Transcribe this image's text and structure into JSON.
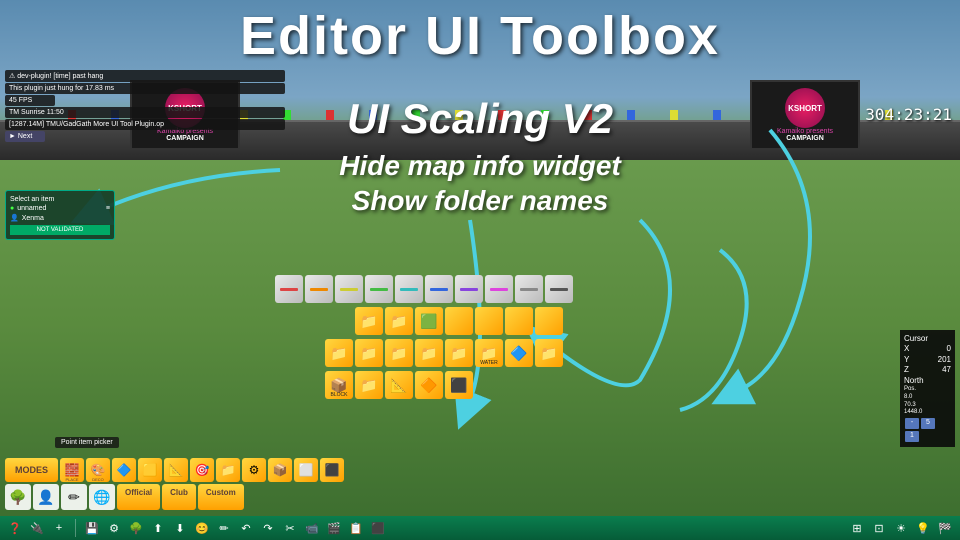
{
  "headline": {
    "h1": "Editor UI Toolbox",
    "h2": "UI Scaling V2",
    "h3": "Hide map info widget",
    "h4": "Show folder names"
  },
  "screens": {
    "brand": "KSHORT",
    "sub": "CAMPAIGN",
    "presents": "Kamaiko presents"
  },
  "timer": "304:23:21",
  "topleft": {
    "plugin": "⚠ dev-plugin! [time] past hang",
    "pluginmsg": "This plugin just hung for 17.83 ms",
    "fps": "45 FPS",
    "clock": "TM Sunrise 11:50",
    "path": "[1287.14M] TMU/GadGath More UI Tool Plugin.op",
    "btn": "► Next"
  },
  "mapinfo": {
    "title": "Select an item",
    "user": "unnamed",
    "author": "Xenma",
    "status": "NOT VALIDATED"
  },
  "cursor": {
    "title": "Cursor",
    "x": "0",
    "y": "201",
    "z": "47",
    "dir": "North",
    "pos": "Pos.",
    "p1": "8.0",
    "p2": "70.3",
    "p3": "1448.0",
    "sm": "-",
    "md": "5",
    "lg": "1"
  },
  "itempicker": "Point item picker",
  "grid": {
    "row1": [
      {
        "c": "#d44"
      },
      {
        "c": "#e80"
      },
      {
        "c": "#cc3"
      },
      {
        "c": "#4b4"
      },
      {
        "c": "#3bb"
      },
      {
        "c": "#36d"
      },
      {
        "c": "#84d"
      },
      {
        "c": "#d4d"
      },
      {
        "c": "#888"
      },
      {
        "c": "#555"
      }
    ],
    "row2": [
      "📁",
      "📁",
      "🟩",
      "",
      "",
      "",
      ""
    ],
    "row3": [
      "📁",
      "📁",
      "📁",
      "📁",
      "📁",
      "📁",
      "🔷",
      "📁"
    ],
    "row4": [
      "📦",
      "📁",
      "📐",
      "🔶",
      "⬛"
    ],
    "labels3": [
      "",
      "",
      "",
      "",
      "",
      "WATER",
      "",
      ""
    ],
    "labels4": [
      "BLOCK",
      "",
      "",
      "",
      ""
    ]
  },
  "panel": {
    "modes": "MODES",
    "icons": [
      "🧱",
      "🎨",
      "🔷",
      "🟨",
      "📐",
      "🎯",
      "📁",
      "⚙",
      "📦",
      "⬜",
      "⬛"
    ],
    "iconLabels": [
      "PLACE",
      "DECO",
      "",
      "",
      "",
      "",
      "",
      "",
      "",
      "",
      ""
    ],
    "tools": [
      "🌳",
      "👤",
      "✏",
      "🌐"
    ],
    "tabs": [
      "Official",
      "Club",
      "Custom"
    ]
  },
  "toolbar": {
    "left": [
      "❓",
      "🔌",
      "+"
    ],
    "mid": [
      "💾",
      "⚙",
      "🌳",
      "⬆",
      "⬇",
      "😊",
      "✏",
      "↶",
      "↷",
      "✂",
      "📹",
      "🎬",
      "📋",
      "⬛"
    ],
    "right": [
      "⊞",
      "⊡",
      "☀",
      "💡",
      "🏁"
    ]
  }
}
